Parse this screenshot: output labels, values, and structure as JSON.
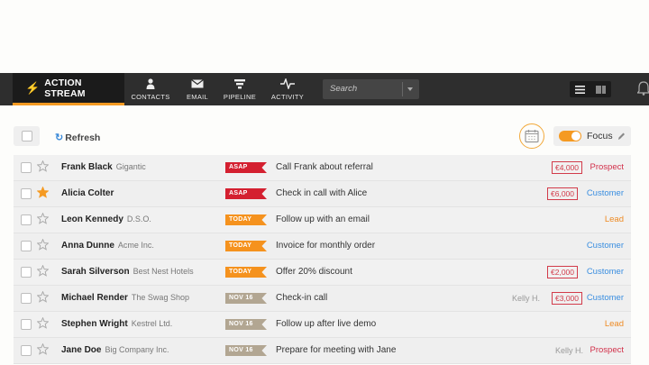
{
  "navbar": {
    "active_label": "ACTION STREAM",
    "items": [
      {
        "label": "CONTACTS",
        "icon": "person-icon"
      },
      {
        "label": "EMAIL",
        "icon": "envelope-icon"
      },
      {
        "label": "PIPELINE",
        "icon": "funnel-icon"
      },
      {
        "label": "ACTIVITY",
        "icon": "pulse-icon"
      }
    ],
    "search_placeholder": "Search"
  },
  "toolbar": {
    "refresh_label": "Refresh",
    "focus_label": "Focus",
    "focus_on": true
  },
  "colors": {
    "accent": "#f59a22",
    "asap": "#d42030",
    "today": "#f5921e",
    "date": "#b2a692",
    "customer": "#3a8ee0",
    "prospect": "#d2304a",
    "lead": "#ee8a22"
  },
  "rows": [
    {
      "name": "Frank Black",
      "company": "Gigantic",
      "starred": false,
      "tag": "ASAP",
      "tag_kind": "asap",
      "task": "Call Frank about referral",
      "owner": "",
      "amount": "€4,000",
      "status": "Prospect"
    },
    {
      "name": "Alicia Colter",
      "company": "",
      "starred": true,
      "tag": "ASAP",
      "tag_kind": "asap",
      "task": "Check in call with Alice",
      "owner": "",
      "amount": "€6,000",
      "status": "Customer"
    },
    {
      "name": "Leon Kennedy",
      "company": "D.S.O.",
      "starred": false,
      "tag": "TODAY",
      "tag_kind": "today",
      "task": "Follow up with an email",
      "owner": "",
      "amount": "",
      "status": "Lead"
    },
    {
      "name": "Anna Dunne",
      "company": "Acme Inc.",
      "starred": false,
      "tag": "TODAY",
      "tag_kind": "today",
      "task": "Invoice for monthly order",
      "owner": "",
      "amount": "",
      "status": "Customer"
    },
    {
      "name": "Sarah Silverson",
      "company": "Best Nest Hotels",
      "starred": false,
      "tag": "TODAY",
      "tag_kind": "today",
      "task": "Offer 20% discount",
      "owner": "",
      "amount": "€2,000",
      "status": "Customer"
    },
    {
      "name": "Michael Render",
      "company": "The Swag Shop",
      "starred": false,
      "tag": "NOV 16",
      "tag_kind": "date",
      "task": "Check-in call",
      "owner": "Kelly H.",
      "amount": "€3,000",
      "status": "Customer"
    },
    {
      "name": "Stephen Wright",
      "company": "Kestrel Ltd.",
      "starred": false,
      "tag": "NOV 16",
      "tag_kind": "date",
      "task": "Follow up after live demo",
      "owner": "",
      "amount": "",
      "status": "Lead"
    },
    {
      "name": "Jane Doe",
      "company": "Big Company Inc.",
      "starred": false,
      "tag": "NOV 16",
      "tag_kind": "date",
      "task": "Prepare for meeting with Jane",
      "owner": "Kelly H.",
      "amount": "",
      "status": "Prospect"
    }
  ]
}
